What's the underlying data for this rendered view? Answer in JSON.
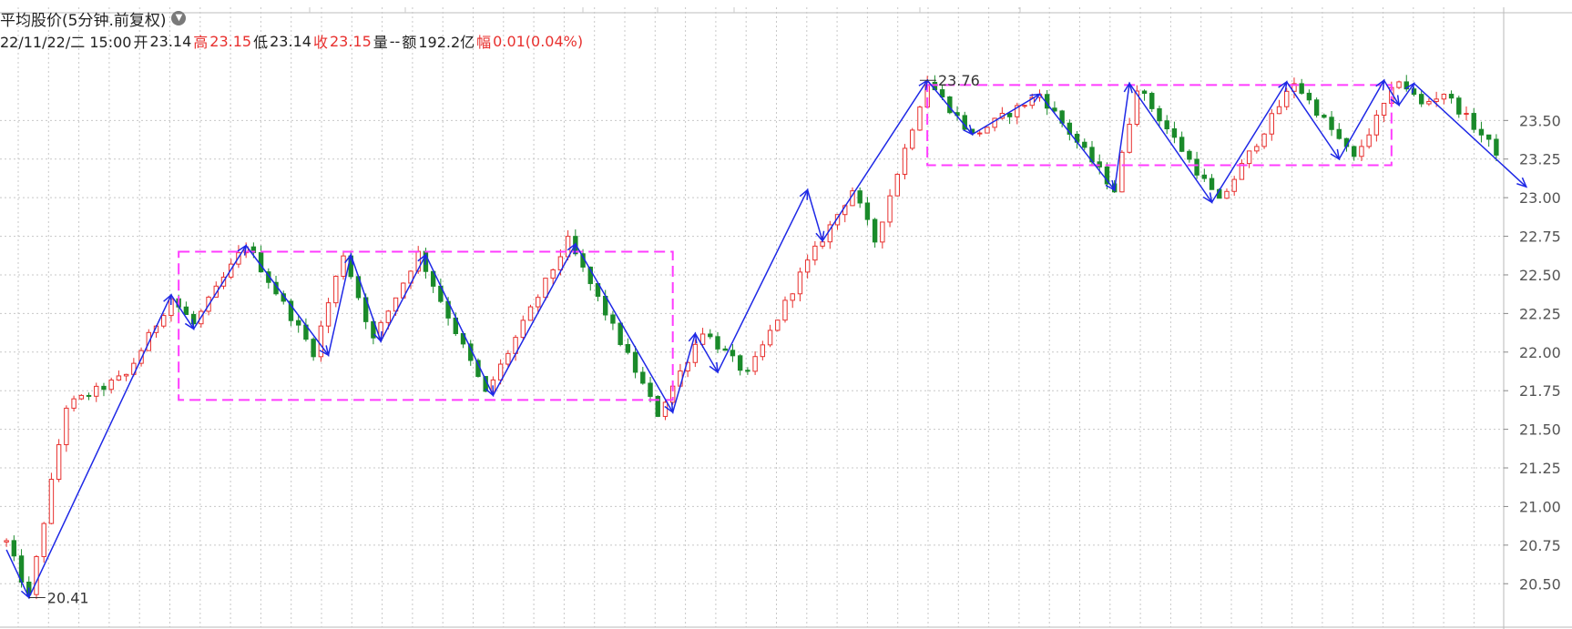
{
  "header": {
    "title": "平均股价(5分钟.前复权)",
    "dropdown_icon": "chevron-down-icon",
    "info": {
      "datetime": "22/11/22/二 15:00",
      "open_label": "开",
      "open_value": "23.14",
      "high_label": "高",
      "high_value": "23.15",
      "low_label": "低",
      "low_value": "23.14",
      "close_label": "收",
      "close_value": "23.15",
      "volume_label": "量",
      "volume_value": "--",
      "amount_label": "额",
      "amount_value": "192.2亿",
      "change_label": "幅",
      "change_value": "0.01(0.04%)"
    }
  },
  "colors": {
    "up": "#e8302e",
    "down": "#1a8a2a",
    "zigzag": "#1e28e6",
    "box": "#ff3cff",
    "grid": "#c8c8c8",
    "axis_text": "#555555"
  },
  "chart_data": {
    "type": "candlestick",
    "ylim": [
      20.36,
      23.95
    ],
    "y_ticks": [
      "23.50",
      "23.25",
      "23.00",
      "22.75",
      "22.50",
      "22.25",
      "22.00",
      "21.75",
      "21.50",
      "21.25",
      "21.00",
      "20.75",
      "20.50"
    ],
    "y_tick_values": [
      23.5,
      23.25,
      23.0,
      22.75,
      22.5,
      22.25,
      22.0,
      21.75,
      21.5,
      21.25,
      21.0,
      20.75,
      20.5
    ],
    "bar_count": 200,
    "annotations": [
      {
        "text": "20.41",
        "value": 20.41,
        "bar": 3
      },
      {
        "text": "23.76",
        "value": 23.76,
        "bar": 122
      }
    ],
    "price_path": [
      [
        0,
        20.77
      ],
      [
        3,
        20.41
      ],
      [
        8,
        21.65
      ],
      [
        16,
        21.85
      ],
      [
        22,
        22.35
      ],
      [
        25,
        22.18
      ],
      [
        32,
        22.7
      ],
      [
        41,
        22.0
      ],
      [
        45,
        22.64
      ],
      [
        49,
        22.08
      ],
      [
        55,
        22.64
      ],
      [
        64,
        21.73
      ],
      [
        75,
        22.72
      ],
      [
        87,
        21.6
      ],
      [
        93,
        22.14
      ],
      [
        99,
        21.85
      ],
      [
        106,
        22.5
      ],
      [
        113,
        23.05
      ],
      [
        116,
        22.72
      ],
      [
        123,
        23.76
      ],
      [
        129,
        23.4
      ],
      [
        138,
        23.67
      ],
      [
        148,
        23.05
      ],
      [
        151,
        23.72
      ],
      [
        162,
        22.97
      ],
      [
        172,
        23.75
      ],
      [
        180,
        23.25
      ],
      [
        186,
        23.77
      ],
      [
        189,
        23.6
      ],
      [
        192,
        23.68
      ],
      [
        203,
        23.08
      ]
    ],
    "zigzag": [
      [
        0,
        20.72
      ],
      [
        3,
        20.41
      ],
      [
        22,
        22.37
      ],
      [
        25,
        22.15
      ],
      [
        32,
        22.69
      ],
      [
        43,
        21.98
      ],
      [
        46,
        22.63
      ],
      [
        50,
        22.07
      ],
      [
        56,
        22.63
      ],
      [
        65,
        21.72
      ],
      [
        76,
        22.7
      ],
      [
        89,
        21.61
      ],
      [
        92,
        22.12
      ],
      [
        95,
        21.87
      ],
      [
        107,
        23.05
      ],
      [
        109,
        22.72
      ],
      [
        123,
        23.76
      ],
      [
        129,
        23.41
      ],
      [
        138,
        23.67
      ],
      [
        148,
        23.05
      ],
      [
        150,
        23.74
      ],
      [
        161,
        22.97
      ],
      [
        171,
        23.75
      ],
      [
        178,
        23.25
      ],
      [
        184,
        23.76
      ],
      [
        186,
        23.6
      ],
      [
        188,
        23.74
      ],
      [
        203,
        23.07
      ]
    ],
    "boxes": [
      {
        "x_start": 23,
        "x_end": 89,
        "y_high": 22.65,
        "y_low": 21.69
      },
      {
        "x_start": 123,
        "x_end": 185,
        "y_high": 23.73,
        "y_low": 23.21
      }
    ]
  }
}
